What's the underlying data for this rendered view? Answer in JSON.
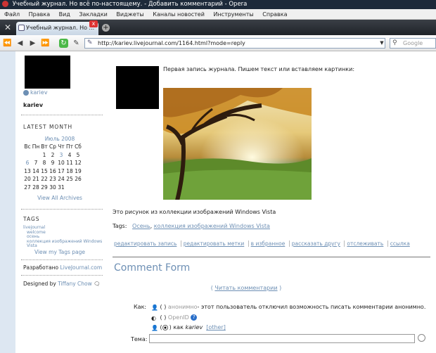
{
  "window": {
    "title": "Учебный журнал. Но всё по-настоящему. - Добавить комментарий - Opera"
  },
  "menu": [
    "Файл",
    "Правка",
    "Вид",
    "Закладки",
    "Виджеты",
    "Каналы новостей",
    "Инструменты",
    "Справка"
  ],
  "tab": {
    "label": "Учебный журнал. Но ...",
    "close": "x",
    "newtab": "+"
  },
  "nav": {
    "url": "http://kariev.livejournal.com/1164.html?mode=reply",
    "search_placeholder": "Google"
  },
  "sidebar": {
    "user_link": "kariev",
    "username": "kariev",
    "latest_month_heading": "LATEST MONTH",
    "month": "Июль 2008",
    "weekdays": [
      "Вс",
      "Пн",
      "Вт",
      "Ср",
      "Чт",
      "Пт",
      "Сб"
    ],
    "weeks": [
      [
        "",
        "",
        "1",
        "2",
        "3",
        "4",
        "5"
      ],
      [
        "6",
        "7",
        "8",
        "9",
        "10",
        "11",
        "12"
      ],
      [
        "13",
        "14",
        "15",
        "16",
        "17",
        "18",
        "19"
      ],
      [
        "20",
        "21",
        "22",
        "23",
        "24",
        "25",
        "26"
      ],
      [
        "27",
        "28",
        "29",
        "30",
        "31",
        "",
        ""
      ]
    ],
    "linked_days": [
      "3",
      "6"
    ],
    "all_archives": "View All Archives",
    "tags_heading": "TAGS",
    "tags": [
      "livejournal",
      "welcome",
      "осень",
      "коллекция изображений Windows Vista"
    ],
    "my_tags": "View my Tags page",
    "powered_prefix": "Разработано",
    "powered_link": "LiveJournal.com",
    "designed_prefix": "Designed by",
    "designed_link": "Tiffany Chow"
  },
  "post": {
    "text": "Первая запись журнала. Пишем текст или вставляем картинки:",
    "caption": "Это рисунок из коллекции изображений Windows Vista",
    "tags_label": "Tags:",
    "tag1": "Осень",
    "tag2": "коллекция изображений Windows Vista",
    "actions": [
      "редактировать запись",
      "редактировать метки",
      "в избранное",
      "рассказать другу",
      "отслеживать",
      "ссылка"
    ]
  },
  "form": {
    "title": "Comment Form",
    "read_comments": "Читать комментарии",
    "as_label": "Как:",
    "anon_paren": "( )",
    "anon_label": "анонимно",
    "anon_disabled": "- этот пользователь отключил возможность писать комментарии анонимно.",
    "openid_paren": "( )",
    "openid_label": "OpenID",
    "as_user_prefix": "как",
    "as_user_name": "kariev",
    "other": "[other]",
    "subject_label": "Тема:"
  },
  "colors": {
    "link": "#6d8fb4",
    "titlebar": "#1d2a3a",
    "leftbar": "#dde7f2"
  }
}
